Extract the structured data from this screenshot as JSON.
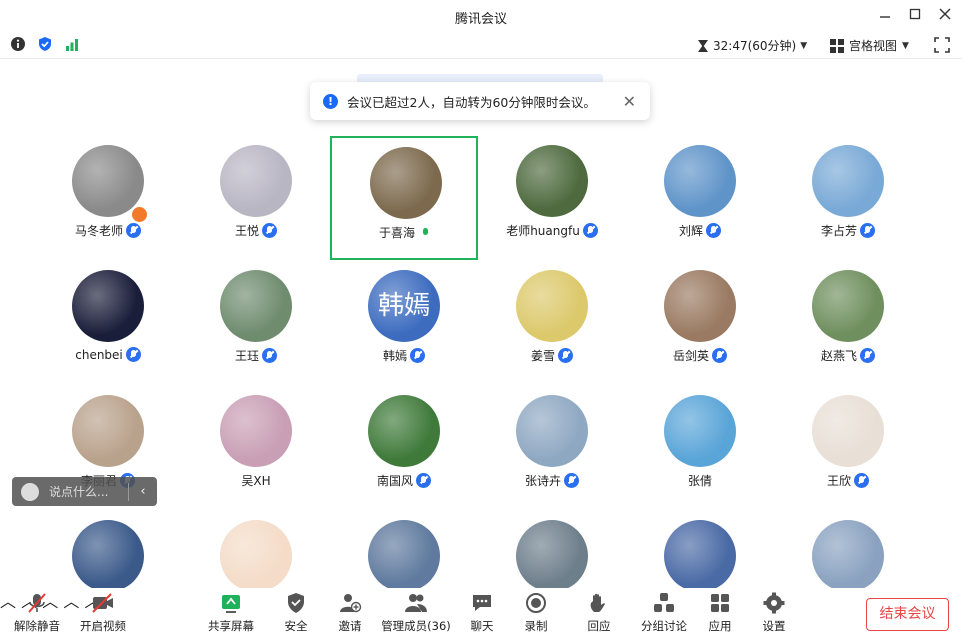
{
  "window": {
    "title": "腾讯会议"
  },
  "topbar": {
    "timer": "32:47(60分钟)",
    "view": "宫格视图"
  },
  "notice": {
    "text": "会议已超过2人，自动转为60分钟限时会议。"
  },
  "participants": [
    {
      "name": "马冬老师",
      "bg": "#8a8a8a"
    },
    {
      "name": "王悦",
      "bg": "#b9b6c4"
    },
    {
      "name": "于喜海",
      "bg": "#7d6a4e"
    },
    {
      "name": "老师huangfu",
      "bg": "#4e6a3e"
    },
    {
      "name": "刘辉",
      "bg": "#5f94c9"
    },
    {
      "name": "李占芳",
      "bg": "#79a9d6"
    },
    {
      "name": "chenbei",
      "bg": "#1b1e3a"
    },
    {
      "name": "王珏",
      "bg": "#6f8c6f"
    },
    {
      "name": "韩嫣",
      "bg": "#3d6cbf",
      "text": "韩嫣"
    },
    {
      "name": "姜雪",
      "bg": "#dcc96c"
    },
    {
      "name": "岳剑英",
      "bg": "#9a7a62"
    },
    {
      "name": "赵燕飞",
      "bg": "#6f8f5e"
    },
    {
      "name": "李丽君",
      "bg": "#b9a28c"
    },
    {
      "name": "吴XH",
      "bg": "#c99fb5"
    },
    {
      "name": "南国风",
      "bg": "#3f7a3a"
    },
    {
      "name": "张诗卉",
      "bg": "#8fa8c2"
    },
    {
      "name": "张倩",
      "bg": "#5aa5d8"
    },
    {
      "name": "王欣",
      "bg": "#e8dfd6"
    },
    {
      "name": "",
      "bg": "#3b5a8a"
    },
    {
      "name": "",
      "bg": "#f4dcc8"
    },
    {
      "name": "",
      "bg": "#5f7a9e"
    },
    {
      "name": "",
      "bg": "#6e7f8c"
    },
    {
      "name": "",
      "bg": "#4a6aa5"
    },
    {
      "name": "",
      "bg": "#8aa2c0"
    }
  ],
  "chat": {
    "placeholder": "说点什么..."
  },
  "toolbar": {
    "unmute": "解除静音",
    "video": "开启视频",
    "share": "共享屏幕",
    "security": "安全",
    "invite": "邀请",
    "members": "管理成员(36)",
    "chat": "聊天",
    "record": "录制",
    "react": "回应",
    "breakout": "分组讨论",
    "apps": "应用",
    "settings": "设置",
    "end": "结束会议"
  }
}
